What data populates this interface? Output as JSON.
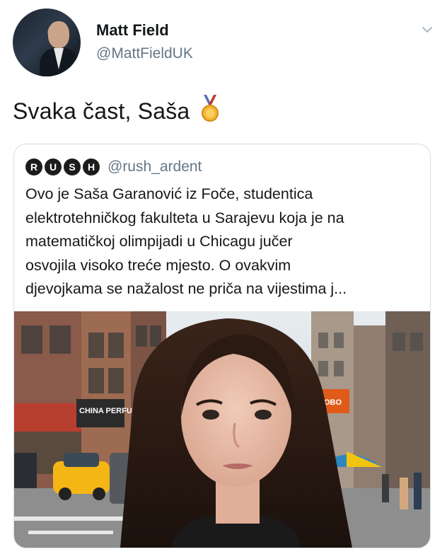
{
  "tweet": {
    "display_name": "Matt Field",
    "handle": "@MattFieldUK",
    "text": "Svaka čast, Saša",
    "emoji_icon": "medal-icon"
  },
  "quoted_tweet": {
    "badges": [
      "R",
      "U",
      "S",
      "H"
    ],
    "handle": "@rush_ardent",
    "lines": [
      "Ovo je Saša Garanović iz Foče, studentica",
      "elektrotehničkog fakulteta u Sarajevu koja je na",
      "matematičkoj olimpijadi u Chicagu jučer",
      "osvojila visoko treće mjesto. O ovakvim",
      "djevojkama se nažalost ne priča na vijestima j..."
    ],
    "photo_icon": "street-selfie-photo",
    "signs": [
      "CHINA PERFUME",
      "HOBO"
    ]
  },
  "colors": {
    "text": "#14171a",
    "secondary": "#657786",
    "border": "#d6dde3"
  }
}
